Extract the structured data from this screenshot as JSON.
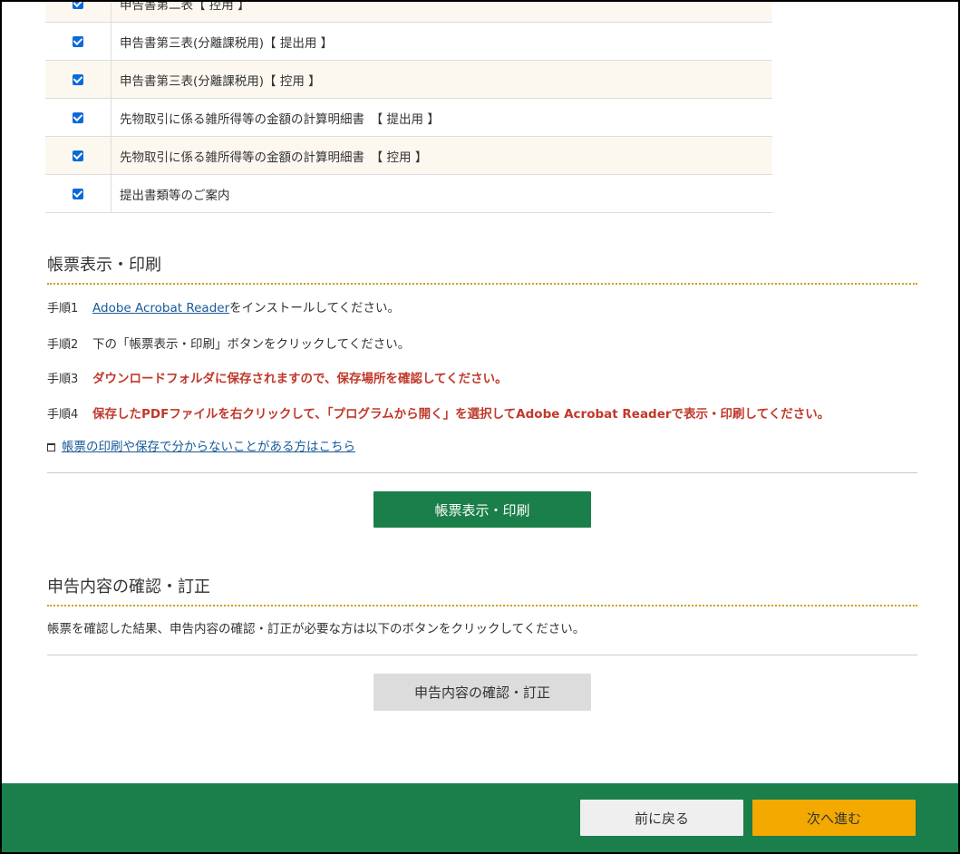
{
  "forms": [
    {
      "label": "申告書第二表【 控用 】",
      "checked": true
    },
    {
      "label": "申告書第三表(分離課税用)【 提出用 】",
      "checked": true
    },
    {
      "label": "申告書第三表(分離課税用)【 控用 】",
      "checked": true
    },
    {
      "label": "先物取引に係る雑所得等の金額の計算明細書　【 提出用 】",
      "checked": true
    },
    {
      "label": "先物取引に係る雑所得等の金額の計算明細書　【 控用 】",
      "checked": true
    },
    {
      "label": "提出書類等のご案内",
      "checked": true
    }
  ],
  "print_section": {
    "title": "帳票表示・印刷",
    "steps": [
      {
        "num": "手順1",
        "link": "Adobe Acrobat Reader",
        "text": "をインストールしてください。"
      },
      {
        "num": "手順2",
        "text": "下の「帳票表示・印刷」ボタンをクリックしてください。"
      },
      {
        "num": "手順3",
        "text": "ダウンロードフォルダに保存されますので、保存場所を確認してください。"
      },
      {
        "num": "手順4",
        "text": "保存したPDFファイルを右クリックして、「プログラムから開く」を選択してAdobe Acrobat Readerで表示・印刷してください。"
      }
    ],
    "help_link": "帳票の印刷や保存で分からないことがある方はこちら",
    "button": "帳票表示・印刷"
  },
  "confirm_section": {
    "title": "申告内容の確認・訂正",
    "description": "帳票を確認した結果、申告内容の確認・訂正が必要な方は以下のボタンをクリックしてください。",
    "button": "申告内容の確認・訂正"
  },
  "footer": {
    "back": "前に戻る",
    "next": "次へ進む"
  },
  "colors": {
    "primary_green": "#1a7f4a",
    "next_button": "#f3a900",
    "emphasis_red": "#c0392b",
    "checkbox_blue": "#0b6ad9"
  }
}
